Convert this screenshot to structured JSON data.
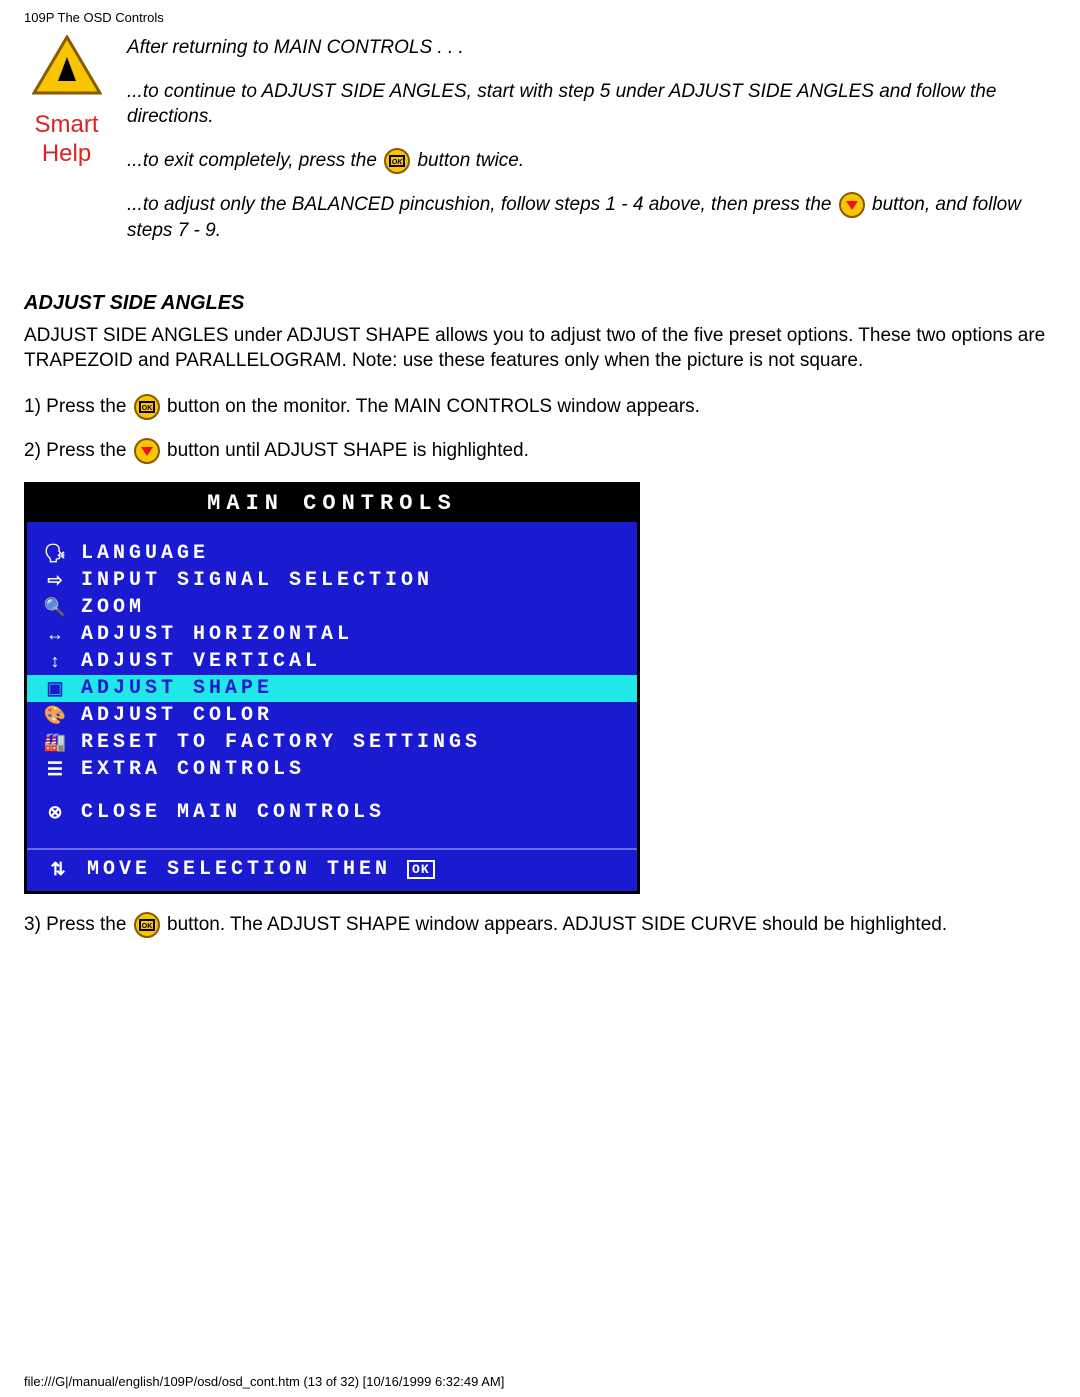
{
  "header": "109P The OSD Controls",
  "smart_help": {
    "title_line1": "Smart",
    "title_line2": "Help",
    "p1": "After returning to MAIN CONTROLS . . .",
    "p2": "...to continue to ADJUST SIDE ANGLES, start with step 5 under ADJUST SIDE ANGLES and follow the directions.",
    "p3a": "...to exit completely, press the ",
    "p3b": " button twice.",
    "p4a": "...to adjust only the BALANCED pincushion, follow steps 1 - 4 above, then press the ",
    "p4b": " button, and follow steps 7 - 9."
  },
  "section": {
    "title": "ADJUST SIDE ANGLES",
    "intro": "ADJUST SIDE ANGLES under ADJUST SHAPE allows you to adjust two of the five preset options. These two options are TRAPEZOID and PARALLELOGRAM. Note: use these features only when the picture is not square.",
    "step1a": "1) Press the ",
    "step1b": " button on the monitor. The MAIN CONTROLS window appears.",
    "step2a": "2) Press the ",
    "step2b": " button until ADJUST SHAPE is highlighted.",
    "step3a": "3) Press the ",
    "step3b": " button. The ADJUST SHAPE window appears. ADJUST SIDE CURVE should be highlighted."
  },
  "osd": {
    "title": "MAIN CONTROLS",
    "items": [
      {
        "icon": "🗣",
        "label": "LANGUAGE",
        "hl": false
      },
      {
        "icon": "⇨",
        "label": "INPUT SIGNAL SELECTION",
        "hl": false
      },
      {
        "icon": "🔍",
        "label": "ZOOM",
        "hl": false
      },
      {
        "icon": "↔",
        "label": "ADJUST HORIZONTAL",
        "hl": false
      },
      {
        "icon": "↕",
        "label": "ADJUST VERTICAL",
        "hl": false
      },
      {
        "icon": "▣",
        "label": "ADJUST SHAPE",
        "hl": true
      },
      {
        "icon": "🎨",
        "label": "ADJUST COLOR",
        "hl": false
      },
      {
        "icon": "🏭",
        "label": "RESET TO FACTORY SETTINGS",
        "hl": false
      },
      {
        "icon": "☰",
        "label": "EXTRA CONTROLS",
        "hl": false
      }
    ],
    "close": {
      "icon": "⊗",
      "label": "CLOSE MAIN CONTROLS"
    },
    "footer": {
      "icon": "⇅",
      "label": "MOVE SELECTION THEN",
      "ok": "OK"
    }
  },
  "footer_path": "file:///G|/manual/english/109P/osd/osd_cont.htm (13 of 32) [10/16/1999 6:32:49 AM]"
}
